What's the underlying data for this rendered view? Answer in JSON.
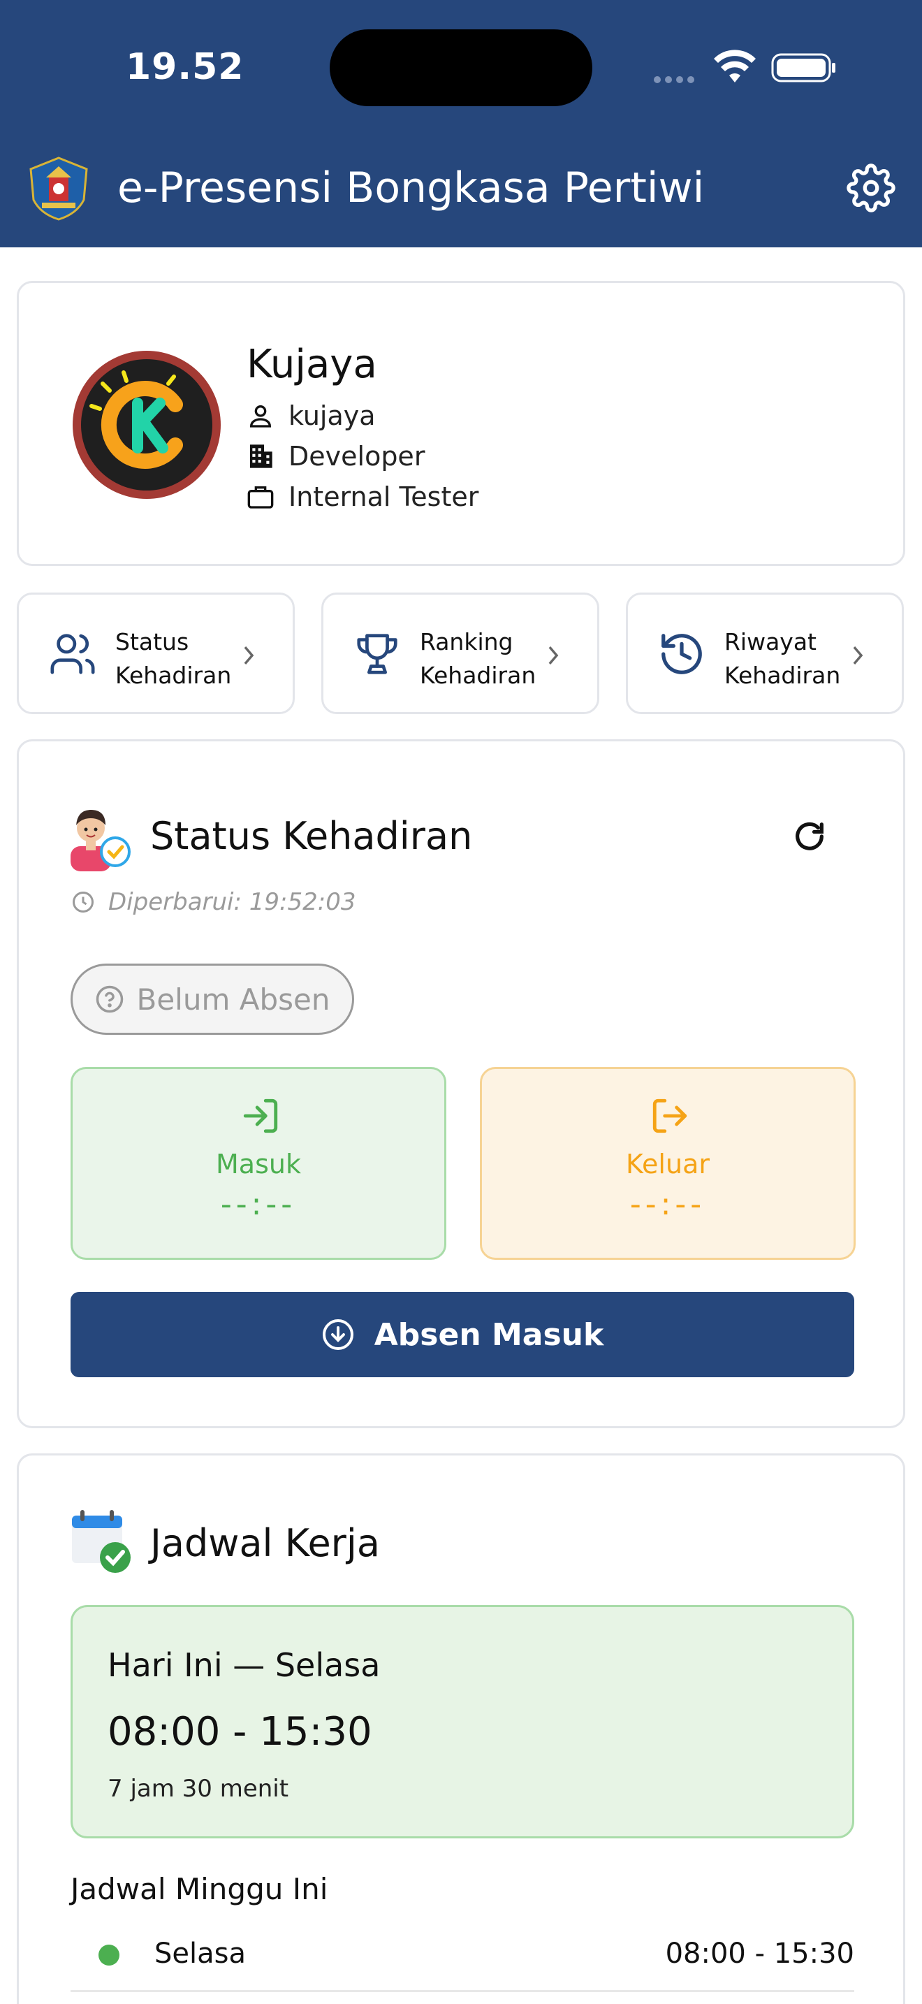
{
  "status_bar": {
    "time": "19.52"
  },
  "header": {
    "title": "e-Presensi Bongkasa Pertiwi",
    "icons": [
      "logo-emblem",
      "gear-icon"
    ]
  },
  "profile": {
    "name": "Kujaya",
    "username": "kujaya",
    "department": "Developer",
    "position": "Internal Tester",
    "icons": [
      "person-icon",
      "building-icon",
      "briefcase-icon"
    ]
  },
  "quick_actions": [
    {
      "line1": "Status",
      "line2": "Kehadiran",
      "icon": "users-icon"
    },
    {
      "line1": "Ranking",
      "line2": "Kehadiran",
      "icon": "trophy-icon"
    },
    {
      "line1": "Riwayat",
      "line2": "Kehadiran",
      "icon": "history-icon"
    }
  ],
  "attendance": {
    "title": "Status Kehadiran",
    "updated": "Diperbarui: 19:52:03",
    "badge": "Belum Absen",
    "check_in": {
      "label": "Masuk",
      "value": "--:--"
    },
    "check_out": {
      "label": "Keluar",
      "value": "--:--"
    },
    "button": "Absen Masuk"
  },
  "schedule": {
    "title": "Jadwal Kerja",
    "today": {
      "day": "Hari Ini — Selasa",
      "time": "08:00 - 15:30",
      "duration": "7 jam 30 menit"
    },
    "week_title": "Jadwal Minggu Ini",
    "week": [
      {
        "day": "Selasa",
        "time": "08:00 - 15:30"
      }
    ]
  },
  "colors": {
    "primary": "#26477c",
    "success": "#4caf50",
    "warning": "#f5a316",
    "muted": "#9a9a9a"
  }
}
